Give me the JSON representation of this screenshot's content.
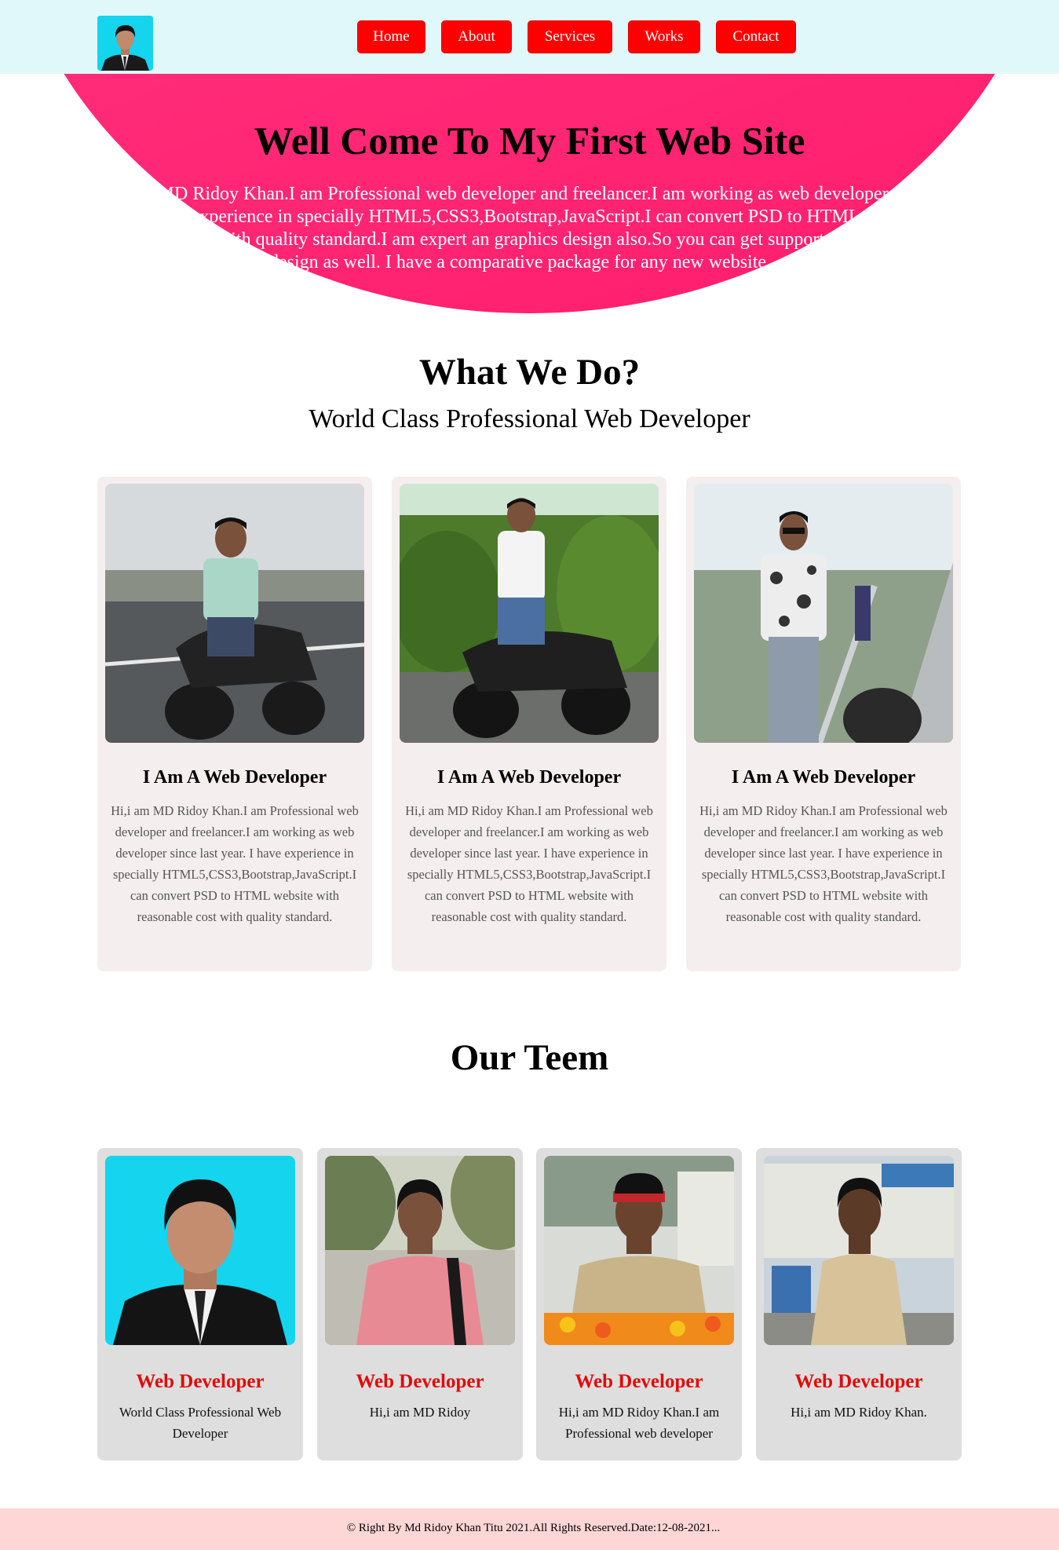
{
  "header": {
    "avatar_icon": "person-portrait-icon",
    "nav": [
      {
        "label": "Home"
      },
      {
        "label": "About"
      },
      {
        "label": "Services"
      },
      {
        "label": "Works"
      },
      {
        "label": "Contact"
      }
    ]
  },
  "hero": {
    "title": "Well Come To My First Web Site",
    "text": "Hi,i am MD Ridoy Khan.I am Professional web developer and freelancer.I am working as web developer since last year. I have experience in specially HTML5,CSS3,Bootstrap,JavaScript.I can convert PSD to HTML website with reasonable cost with quality standard.I am expert an graphics design also.So you can get support any web template design as well. I have a comparative package for any new website....."
  },
  "services": {
    "title": "What We Do?",
    "subtitle": "World Class Professional Web Developer",
    "cards": [
      {
        "photo": "man-on-motorbike-photo",
        "title": "I Am A Web Developer",
        "text": "Hi,i am MD Ridoy Khan.I am Professional web developer and freelancer.I am working as web developer since last year. I have experience in specially HTML5,CSS3,Bootstrap,JavaScript.I can convert PSD to HTML website with reasonable cost with quality standard."
      },
      {
        "photo": "man-on-motorbike-photo",
        "title": "I Am A Web Developer",
        "text": "Hi,i am MD Ridoy Khan.I am Professional web developer and freelancer.I am working as web developer since last year. I have experience in specially HTML5,CSS3,Bootstrap,JavaScript.I can convert PSD to HTML website with reasonable cost with quality standard."
      },
      {
        "photo": "man-standing-by-road-photo",
        "title": "I Am A Web Developer",
        "text": "Hi,i am MD Ridoy Khan.I am Professional web developer and freelancer.I am working as web developer since last year. I have experience in specially HTML5,CSS3,Bootstrap,JavaScript.I can convert PSD to HTML website with reasonable cost with quality standard."
      }
    ]
  },
  "team": {
    "title": "Our Teem",
    "members": [
      {
        "photo": "portrait-photo",
        "role": "Web Developer",
        "desc": "World Class Professional Web Developer"
      },
      {
        "photo": "portrait-photo",
        "role": "Web Developer",
        "desc": "Hi,i am MD Ridoy"
      },
      {
        "photo": "portrait-photo",
        "role": "Web Developer",
        "desc": "Hi,i am MD Ridoy Khan.I am Professional web developer"
      },
      {
        "photo": "portrait-photo",
        "role": "Web Developer",
        "desc": "Hi,i am MD Ridoy Khan."
      }
    ]
  },
  "footer": {
    "text": "© Right By Md Ridoy Khan Titu 2021.All Rights Reserved.Date:12-08-2021..."
  },
  "colors": {
    "header_bg": "#e0f8fa",
    "nav_button": "#ff0000",
    "hero_pink": "#ff2b78",
    "card_bg": "#f5eeee",
    "team_card_bg": "#dedede",
    "role_red": "#e00b0b",
    "footer_bg": "#ffd6d6"
  }
}
